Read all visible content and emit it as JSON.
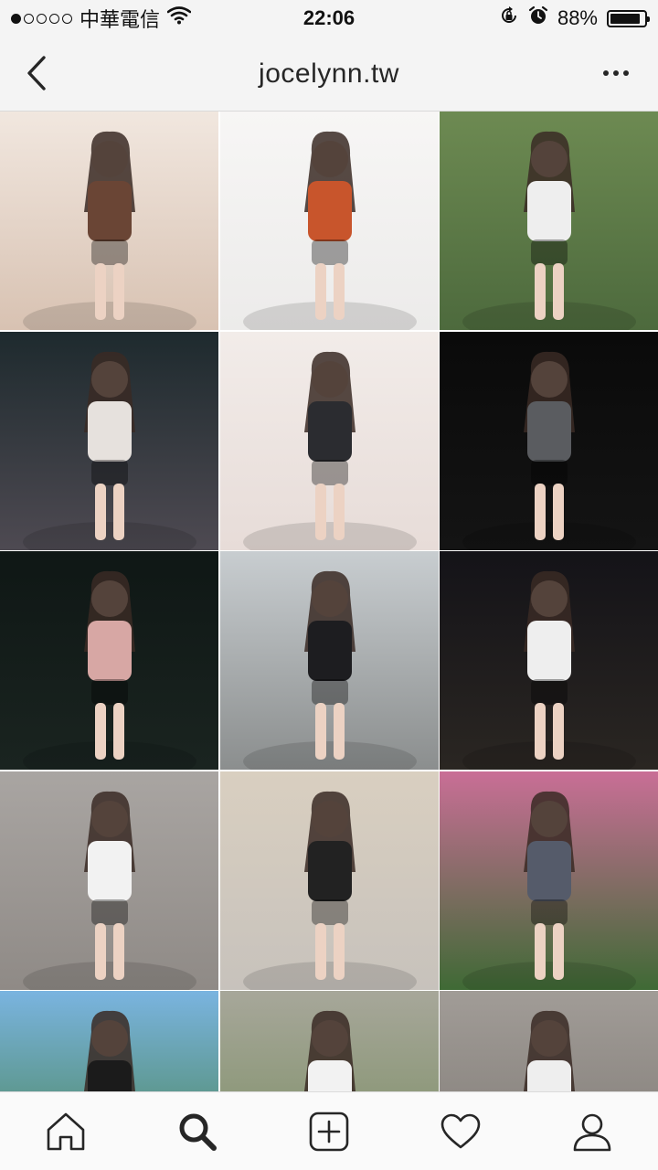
{
  "status_bar": {
    "carrier": "中華電信",
    "time": "22:06",
    "battery": "88%",
    "battery_level": 0.88,
    "signal_bars_filled": 1,
    "signal_bars_total": 5
  },
  "nav": {
    "username": "jocelynn.tw"
  },
  "photos": [
    {
      "name": "photo-selfie-with-plush-bear",
      "bg": "#d8c2b2",
      "top": "#f1e7df",
      "figure": "#6a4535"
    },
    {
      "name": "photo-orange-top-white-wall",
      "bg": "#ecebea",
      "top": "#f7f6f5",
      "figure": "#c8552c"
    },
    {
      "name": "photo-white-tee-green-ivy",
      "bg": "#4d6a3d",
      "top": "#6d8a52",
      "figure": "#eeeeee"
    },
    {
      "name": "photo-night-street-shorts",
      "bg": "#4e4a52",
      "top": "#1e2a2e",
      "figure": "#e6e1dd"
    },
    {
      "name": "photo-black-top-ponytail",
      "bg": "#e7dcd8",
      "top": "#f2ece9",
      "figure": "#2b2c30"
    },
    {
      "name": "photo-night-car-harbor",
      "bg": "#141414",
      "top": "#0a0a0a",
      "figure": "#5a5c60"
    },
    {
      "name": "photo-pink-umbrella-rain",
      "bg": "#1a2420",
      "top": "#0f1715",
      "figure": "#d7a7a4"
    },
    {
      "name": "photo-street-black-jacket",
      "bg": "#8b8e8e",
      "top": "#c8cdd0",
      "figure": "#1d1d20"
    },
    {
      "name": "photo-night-white-tee",
      "bg": "#2a2622",
      "top": "#141318",
      "figure": "#eeeeee"
    },
    {
      "name": "photo-concrete-wall-black-shorts",
      "bg": "#8f8a86",
      "top": "#a9a5a2",
      "figure": "#f2f2f2"
    },
    {
      "name": "photo-store-plush-toys",
      "bg": "#c7c2bc",
      "top": "#d9cfc0",
      "figure": "#222222"
    },
    {
      "name": "photo-flower-bush-striped-romper",
      "bg": "#3f6a35",
      "top": "#c96e96",
      "figure": "#555b6a"
    },
    {
      "name": "photo-mountain-forest-sky",
      "bg": "#3f7a3a",
      "top": "#7ab4e0",
      "figure": "#1b1b1b"
    },
    {
      "name": "photo-park-white-top",
      "bg": "#748a5b",
      "top": "#a7a79a",
      "figure": "#f2f2f2"
    },
    {
      "name": "photo-road-selfie",
      "bg": "#7a7570",
      "top": "#a19c97",
      "figure": "#eeeeee"
    }
  ]
}
